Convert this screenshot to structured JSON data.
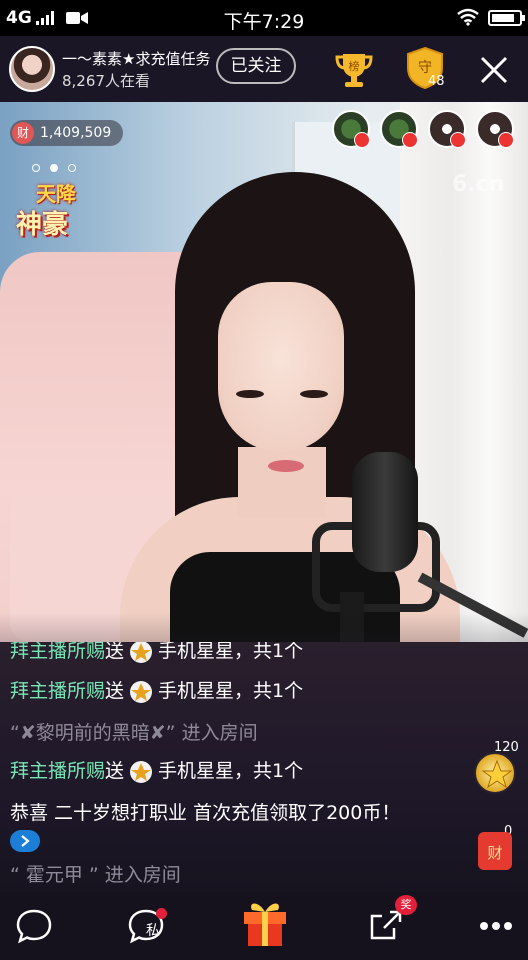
{
  "status_bar": {
    "network": "4G",
    "time": "下午7:29",
    "battery_level": 0.85
  },
  "header": {
    "host_name": "一〜素素★求充值任务",
    "viewers": "8,267人在看",
    "follow_label": "已关注",
    "trophy_label": "榜",
    "guard_label": "守",
    "guard_count": "48"
  },
  "video": {
    "coin_icon_label": "财",
    "coin_count": "1,409,509",
    "watermark": "6.cn",
    "promo": {
      "line1": "天降",
      "line2": "神豪"
    },
    "carousel_active_index": 1
  },
  "chat": {
    "messages": [
      {
        "part1": "拜主播所赐",
        "part2": "送",
        "part3": "手机星星，共1个"
      },
      {
        "part1": "拜主播所赐",
        "part2": "送",
        "part3": "手机星星，共1个"
      },
      {
        "text": "“✘黎明前的黑暗✘” 进入房间"
      },
      {
        "part1": "拜主播所赐",
        "part2": "送",
        "part3": "手机星星，共1个"
      },
      {
        "text": "恭喜 二十岁想打职业 首次充值领取了200币！"
      },
      {
        "text": "“   霍元甲   ” 进入房间"
      }
    ]
  },
  "side": {
    "star_count": "120",
    "redpack_label": "财",
    "redpack_count": "0"
  },
  "bottom_bar": {
    "dm_label": "私",
    "share_badge": "奖"
  },
  "colors": {
    "accent_green": "#76e5b3",
    "badge_red": "#e2203a",
    "chat_bg": "#1e1829"
  }
}
